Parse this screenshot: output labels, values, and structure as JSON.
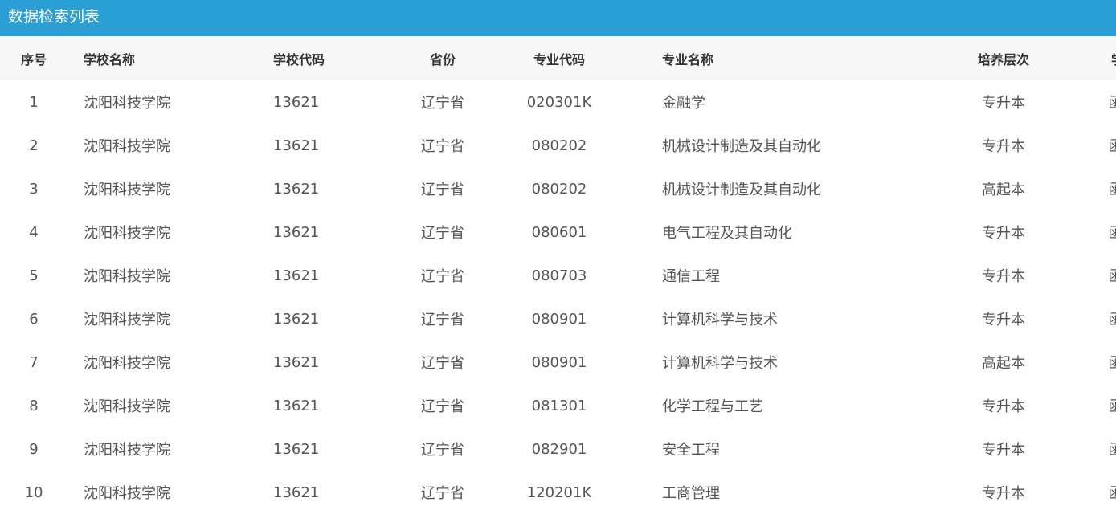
{
  "panel": {
    "title": "数据检索列表"
  },
  "table": {
    "headers": {
      "index": "序号",
      "school_name": "学校名称",
      "school_code": "学校代码",
      "province": "省份",
      "major_code": "专业代码",
      "major_name": "专业名称",
      "level": "培养层次",
      "study_mode": "学习形式"
    },
    "rows": [
      {
        "index": "1",
        "school_name": "沈阳科技学院",
        "school_code": "13621",
        "province": "辽宁省",
        "major_code": "020301K",
        "major_name": "金融学",
        "level": "专升本",
        "study_mode": "函授"
      },
      {
        "index": "2",
        "school_name": "沈阳科技学院",
        "school_code": "13621",
        "province": "辽宁省",
        "major_code": "080202",
        "major_name": "机械设计制造及其自动化",
        "level": "专升本",
        "study_mode": "函授"
      },
      {
        "index": "3",
        "school_name": "沈阳科技学院",
        "school_code": "13621",
        "province": "辽宁省",
        "major_code": "080202",
        "major_name": "机械设计制造及其自动化",
        "level": "高起本",
        "study_mode": "函授"
      },
      {
        "index": "4",
        "school_name": "沈阳科技学院",
        "school_code": "13621",
        "province": "辽宁省",
        "major_code": "080601",
        "major_name": "电气工程及其自动化",
        "level": "专升本",
        "study_mode": "函授"
      },
      {
        "index": "5",
        "school_name": "沈阳科技学院",
        "school_code": "13621",
        "province": "辽宁省",
        "major_code": "080703",
        "major_name": "通信工程",
        "level": "专升本",
        "study_mode": "函授"
      },
      {
        "index": "6",
        "school_name": "沈阳科技学院",
        "school_code": "13621",
        "province": "辽宁省",
        "major_code": "080901",
        "major_name": "计算机科学与技术",
        "level": "专升本",
        "study_mode": "函授"
      },
      {
        "index": "7",
        "school_name": "沈阳科技学院",
        "school_code": "13621",
        "province": "辽宁省",
        "major_code": "080901",
        "major_name": "计算机科学与技术",
        "level": "高起本",
        "study_mode": "函授"
      },
      {
        "index": "8",
        "school_name": "沈阳科技学院",
        "school_code": "13621",
        "province": "辽宁省",
        "major_code": "081301",
        "major_name": "化学工程与工艺",
        "level": "专升本",
        "study_mode": "函授"
      },
      {
        "index": "9",
        "school_name": "沈阳科技学院",
        "school_code": "13621",
        "province": "辽宁省",
        "major_code": "082901",
        "major_name": "安全工程",
        "level": "专升本",
        "study_mode": "函授"
      },
      {
        "index": "10",
        "school_name": "沈阳科技学院",
        "school_code": "13621",
        "province": "辽宁省",
        "major_code": "120201K",
        "major_name": "工商管理",
        "level": "专升本",
        "study_mode": "函授"
      }
    ]
  },
  "colors": {
    "header_bar": "#2a9fd6",
    "table_head_bg": "#f7f7f7"
  }
}
